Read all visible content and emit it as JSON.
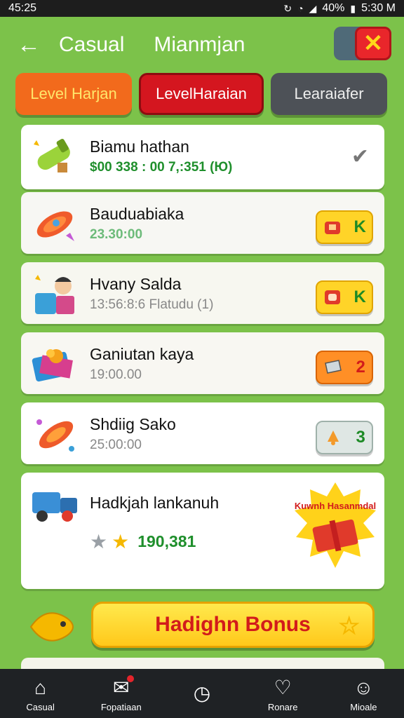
{
  "status_bar": {
    "time": "45:25",
    "battery": "40%",
    "clock": "5:30 M"
  },
  "header": {
    "title_left": "Casual",
    "title_right": "Mianmjan"
  },
  "tabs": [
    {
      "label": "Level Harjan"
    },
    {
      "label": "LevelHaraian"
    },
    {
      "label": "Learaiafer"
    }
  ],
  "items": [
    {
      "name": "Biamu hathan",
      "sub": "$00 338 : 00 7,:351 (Ю)",
      "status": "checked"
    },
    {
      "name": "Bauduabiaka",
      "sub": "23.30:00",
      "badge_value": "K"
    },
    {
      "name": "Hvany Salda",
      "sub": "13:56:8:6 Flatudu (1)",
      "badge_value": "K"
    },
    {
      "name": "Ganiutan kaya",
      "sub": "19:00.00",
      "badge_value": "2"
    },
    {
      "name": "Shdiig Sako",
      "sub": "25:00:00",
      "badge_value": "3"
    },
    {
      "name": "Hadkjah lankanuh",
      "stars_value": "190,381",
      "burst_text": "Kuwnh Hasanmdal"
    }
  ],
  "bonus": {
    "label": "Hadighn Bonus"
  },
  "nav": [
    {
      "label": "Casual"
    },
    {
      "label": "Fopatiaan"
    },
    {
      "label": ""
    },
    {
      "label": "Ronare"
    },
    {
      "label": "Mioale"
    }
  ]
}
